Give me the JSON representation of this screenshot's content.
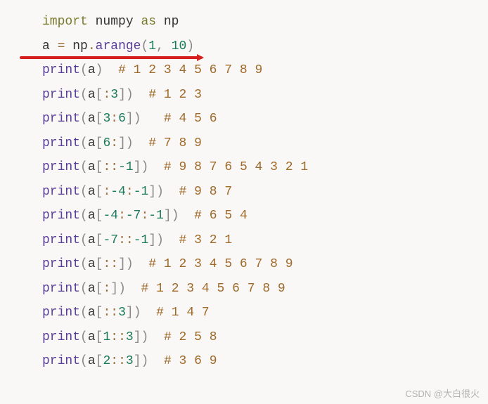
{
  "code": {
    "l0": {
      "kw1": "import",
      "sp1": " ",
      "mod": "numpy",
      "sp2": " ",
      "kw2": "as",
      "sp3": " ",
      "alias": "np"
    },
    "l1": {
      "var": "a",
      "sp1": " ",
      "op": "=",
      "sp2": " ",
      "obj": "np",
      "dot": ".",
      "method": "arange",
      "po": "(",
      "a1": "1",
      "c": ",",
      "sp3": " ",
      "a2": "10",
      "pc": ")"
    },
    "l2": {
      "fn": "print",
      "po": "(",
      "arg": "a",
      "pc": ")",
      "sp": "  ",
      "comment": "# 1 2 3 4 5 6 7 8 9"
    },
    "l3": {
      "fn": "print",
      "po": "(",
      "arg": "a",
      "bo": "[",
      "slice": ":",
      "n1": "3",
      "bc": "]",
      "pc": ")",
      "sp": "  ",
      "comment": "# 1 2 3"
    },
    "l4": {
      "fn": "print",
      "po": "(",
      "arg": "a",
      "bo": "[",
      "n1": "3",
      "slice": ":",
      "n2": "6",
      "bc": "]",
      "pc": ")",
      "sp": "   ",
      "comment": "# 4 5 6"
    },
    "l5": {
      "fn": "print",
      "po": "(",
      "arg": "a",
      "bo": "[",
      "n1": "6",
      "slice": ":",
      "bc": "]",
      "pc": ")",
      "sp": "  ",
      "comment": "# 7 8 9"
    },
    "l6": {
      "fn": "print",
      "po": "(",
      "arg": "a",
      "bo": "[",
      "s1": ":",
      "s2": ":",
      "n1": "-1",
      "bc": "]",
      "pc": ")",
      "sp": "  ",
      "comment": "# 9 8 7 6 5 4 3 2 1"
    },
    "l7": {
      "fn": "print",
      "po": "(",
      "arg": "a",
      "bo": "[",
      "s1": ":",
      "n1": "-4",
      "s2": ":",
      "n2": "-1",
      "bc": "]",
      "pc": ")",
      "sp": "  ",
      "comment": "# 9 8 7"
    },
    "l8": {
      "fn": "print",
      "po": "(",
      "arg": "a",
      "bo": "[",
      "n1": "-4",
      "s1": ":",
      "n2": "-7",
      "s2": ":",
      "n3": "-1",
      "bc": "]",
      "pc": ")",
      "sp": "  ",
      "comment": "# 6 5 4"
    },
    "l9": {
      "fn": "print",
      "po": "(",
      "arg": "a",
      "bo": "[",
      "n1": "-7",
      "s1": ":",
      "s2": ":",
      "n2": "-1",
      "bc": "]",
      "pc": ")",
      "sp": "  ",
      "comment": "# 3 2 1"
    },
    "l10": {
      "fn": "print",
      "po": "(",
      "arg": "a",
      "bo": "[",
      "s1": ":",
      "s2": ":",
      "bc": "]",
      "pc": ")",
      "sp": "  ",
      "comment": "# 1 2 3 4 5 6 7 8 9"
    },
    "l11": {
      "fn": "print",
      "po": "(",
      "arg": "a",
      "bo": "[",
      "s1": ":",
      "bc": "]",
      "pc": ")",
      "sp": "  ",
      "comment": "# 1 2 3 4 5 6 7 8 9"
    },
    "l12": {
      "fn": "print",
      "po": "(",
      "arg": "a",
      "bo": "[",
      "s1": ":",
      "s2": ":",
      "n1": "3",
      "bc": "]",
      "pc": ")",
      "sp": "  ",
      "comment": "# 1 4 7"
    },
    "l13": {
      "fn": "print",
      "po": "(",
      "arg": "a",
      "bo": "[",
      "n1": "1",
      "s1": ":",
      "s2": ":",
      "n2": "3",
      "bc": "]",
      "pc": ")",
      "sp": "  ",
      "comment": "# 2 5 8"
    },
    "l14": {
      "fn": "print",
      "po": "(",
      "arg": "a",
      "bo": "[",
      "n1": "2",
      "s1": ":",
      "s2": ":",
      "n2": "3",
      "bc": "]",
      "pc": ")",
      "sp": "  ",
      "comment": "# 3 6 9"
    }
  },
  "watermark": "CSDN @大白很火"
}
